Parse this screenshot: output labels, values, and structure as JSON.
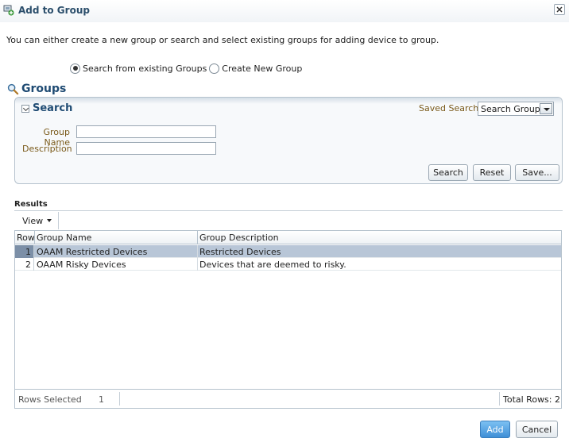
{
  "window": {
    "title": "Add to Group",
    "close_icon": "close-icon",
    "title_icon": "add-group-icon"
  },
  "intro_text": "You can either create a new group or search and select existing groups for adding device to group.",
  "mode": {
    "options": [
      {
        "label": "Search from existing Groups",
        "selected": true
      },
      {
        "label": "Create New Group",
        "selected": false
      }
    ]
  },
  "groups": {
    "title": "Groups",
    "icon": "magnifier-icon"
  },
  "search": {
    "title": "Search",
    "saved_search_label": "Saved Search",
    "saved_search_value": "Search Groups",
    "fields": [
      {
        "label": "Group Name",
        "value": ""
      },
      {
        "label": "Description",
        "value": ""
      }
    ],
    "buttons": {
      "search": "Search",
      "reset": "Reset",
      "save": "Save..."
    }
  },
  "results": {
    "label": "Results",
    "view_menu": "View",
    "columns": [
      "Row",
      "Group Name",
      "Group Description"
    ],
    "rows": [
      {
        "row": "1",
        "name": "OAAM Restricted Devices",
        "description": "Restricted Devices",
        "selected": true
      },
      {
        "row": "2",
        "name": "OAAM Risky Devices",
        "description": "Devices that are deemed to risky.",
        "selected": false
      }
    ],
    "footer": {
      "rows_selected_label": "Rows Selected",
      "rows_selected_value": "1",
      "total_rows": "Total Rows: 2"
    }
  },
  "actions": {
    "add": "Add",
    "cancel": "Cancel"
  },
  "colors": {
    "title": "#2b4e6b",
    "accent": "#1f4b73",
    "label": "#7a5a1a",
    "selected_row": "#b8c6d7",
    "primary_button": "#3f8fd6"
  }
}
